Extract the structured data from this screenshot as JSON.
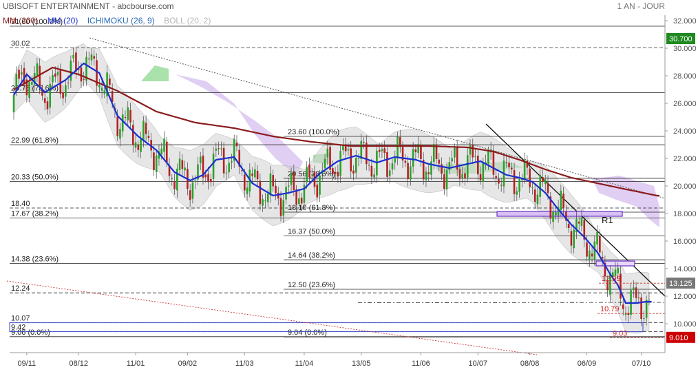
{
  "header": {
    "title": "UBISOFT ENTERTAINMENT - abcbourse.com",
    "period": "1 AN - JOUR"
  },
  "legend": [
    {
      "label": "MM (200)",
      "color": "#8b1c1c"
    },
    {
      "label": "MM (20)",
      "color": "#1a2fd0"
    },
    {
      "label": "ICHIMOKU (26, 9)",
      "color": "#2a6ab8"
    },
    {
      "label": "BOLL (20, 2)",
      "color": "#b5b5b5"
    }
  ],
  "chart_data": {
    "type": "line",
    "title": "UBISOFT ENTERTAINMENT",
    "ylim": [
      8.4,
      32.0
    ],
    "y_ticks": [
      "10.000",
      "12.000",
      "14.000",
      "16.000",
      "18.000",
      "20.000",
      "22.000",
      "24.000",
      "26.000",
      "28.000",
      "30.000",
      "32.000"
    ],
    "y_tick_values": [
      10,
      12,
      14,
      16,
      18,
      20,
      22,
      24,
      26,
      28,
      30,
      32
    ],
    "x_labels": [
      "09/11",
      "08/12",
      "11/01",
      "09/02",
      "11/03",
      "11/04",
      "13/05",
      "11/06",
      "10/07",
      "08/08",
      "06/09",
      "07/10"
    ],
    "x_label_index": [
      5,
      25,
      47,
      67,
      89,
      112,
      134,
      157,
      179,
      199,
      221,
      242
    ],
    "n_sessions": 250,
    "last_price_label": "13.125",
    "price_tag_high": "30.700",
    "price_tag_low": "9.010",
    "fibonacci_left": [
      {
        "value": 31.6,
        "label": "31.60 (100.0%)"
      },
      {
        "value": 30.02,
        "label": "30.02"
      },
      {
        "value": 26.78,
        "label": "26.78 (78.6%)"
      },
      {
        "value": 22.99,
        "label": "22.99 (61.8%)"
      },
      {
        "value": 20.33,
        "label": "20.33 (50.0%)"
      },
      {
        "value": 18.4,
        "label": "18.40"
      },
      {
        "value": 17.67,
        "label": "17.67 (38.2%)"
      },
      {
        "value": 14.38,
        "label": "14.38 (23.6%)"
      },
      {
        "value": 12.24,
        "label": "12.24"
      },
      {
        "value": 10.07,
        "label": "10.07"
      },
      {
        "value": 9.42,
        "label": "9.42"
      },
      {
        "value": 9.06,
        "label": "9.06 (0.0%)"
      }
    ],
    "fibonacci_mid": [
      {
        "value": 23.6,
        "label": "23.60 (100.0%)"
      },
      {
        "value": 20.56,
        "label": "20.56 (78.6%)"
      },
      {
        "value": 18.1,
        "label": "18.10 (61.8%)"
      },
      {
        "value": 16.37,
        "label": "16.37 (50.0%)"
      },
      {
        "value": 14.64,
        "label": "14.64 (38.2%)"
      },
      {
        "value": 12.5,
        "label": "12.50 (23.6%)"
      },
      {
        "value": 9.04,
        "label": "9.04 (0.0%)"
      }
    ],
    "price_labels": [
      {
        "value": 12.99,
        "label": "12.99"
      },
      {
        "value": 10.79,
        "label": "10.79"
      },
      {
        "value": 9.03,
        "label": "9.03"
      }
    ],
    "annotation": {
      "label": "R1",
      "x": 212,
      "y": 17.2
    },
    "series": [
      {
        "name": "MM (200)",
        "color": "#8b1c1c",
        "x": [
          0,
          15,
          25,
          40,
          55,
          70,
          85,
          100,
          115,
          130,
          145,
          160,
          175,
          185,
          195,
          205,
          215,
          225,
          235,
          248
        ],
        "y": [
          27.0,
          28.6,
          28.1,
          26.9,
          25.4,
          24.6,
          24.2,
          23.6,
          23.2,
          22.9,
          22.9,
          22.9,
          22.8,
          22.5,
          21.9,
          21.2,
          20.6,
          20.2,
          19.8,
          19.3
        ]
      },
      {
        "name": "MM (20)",
        "color": "#1a2fd0",
        "x": [
          0,
          5,
          12,
          20,
          27,
          33,
          40,
          48,
          55,
          62,
          68,
          73,
          78,
          85,
          92,
          100,
          106,
          112,
          118,
          125,
          132,
          140,
          147,
          155,
          160,
          168,
          175,
          180,
          185,
          190,
          195,
          200,
          205,
          210,
          215,
          220,
          225,
          230,
          233,
          236,
          240,
          244,
          246
        ],
        "y": [
          26.6,
          28.1,
          26.8,
          27.7,
          28.9,
          28.2,
          25.1,
          23.6,
          22.6,
          21.0,
          20.4,
          20.8,
          21.9,
          22.1,
          20.2,
          19.3,
          19.5,
          19.8,
          20.9,
          21.8,
          22.2,
          21.7,
          22.1,
          21.9,
          21.6,
          21.3,
          21.6,
          21.8,
          21.3,
          20.8,
          20.6,
          20.3,
          19.5,
          18.3,
          17.2,
          16.3,
          15.2,
          13.6,
          12.8,
          11.5,
          11.5,
          11.6,
          11.6
        ]
      }
    ]
  }
}
